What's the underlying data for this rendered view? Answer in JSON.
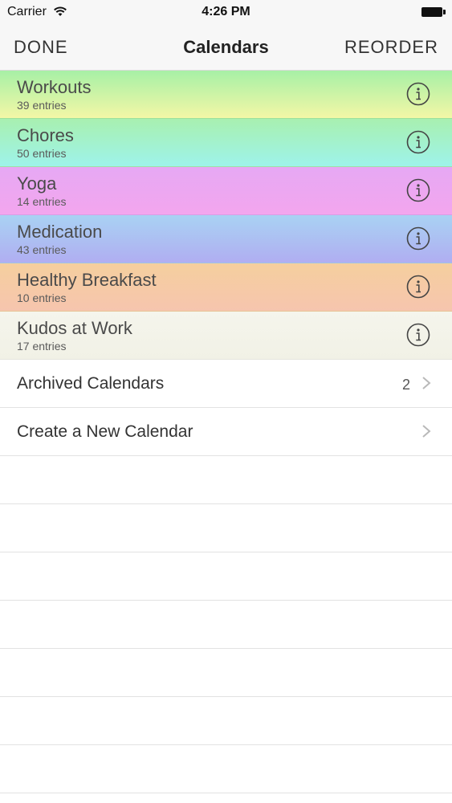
{
  "status_bar": {
    "carrier": "Carrier",
    "time": "4:26 PM"
  },
  "nav": {
    "left": "DONE",
    "title": "Calendars",
    "right": "REORDER"
  },
  "calendars": [
    {
      "name": "Workouts",
      "count": "39 entries",
      "gradient": [
        "#a7f0a6",
        "#f3f7a6"
      ]
    },
    {
      "name": "Chores",
      "count": "50 entries",
      "gradient": [
        "#a8f0b0",
        "#9ef3ea"
      ]
    },
    {
      "name": "Yoga",
      "count": "14 entries",
      "gradient": [
        "#e6a8f4",
        "#f3a6ee"
      ]
    },
    {
      "name": "Medication",
      "count": "43 entries",
      "gradient": [
        "#a9d2f3",
        "#b0aef2"
      ]
    },
    {
      "name": "Healthy Breakfast",
      "count": "10 entries",
      "gradient": [
        "#f5cf9e",
        "#f6c5ae"
      ]
    },
    {
      "name": "Kudos at Work",
      "count": "17 entries",
      "gradient": [
        "#f5f5ec",
        "#f1f1e6"
      ]
    }
  ],
  "archived": {
    "label": "Archived Calendars",
    "count": "2"
  },
  "create": {
    "label": "Create a New Calendar"
  }
}
